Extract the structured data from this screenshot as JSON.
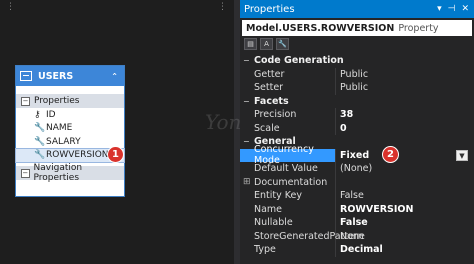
{
  "entity": {
    "name": "USERS",
    "properties_header": "Properties",
    "fields": [
      "ID",
      "NAME",
      "SALARY",
      "ROWVERSION"
    ],
    "nav_header": "Navigation Properties"
  },
  "badges": [
    "1",
    "2"
  ],
  "panel": {
    "title": "Properties",
    "buttons": [
      "▾",
      "⊣",
      "✕"
    ],
    "object_name": "Model.USERS.ROWVERSION",
    "object_type": "Property"
  },
  "grid": [
    {
      "category": "Code Generation",
      "rows": [
        {
          "name": "Getter",
          "value": "Public"
        },
        {
          "name": "Setter",
          "value": "Public"
        }
      ]
    },
    {
      "category": "Facets",
      "rows": [
        {
          "name": "Precision",
          "value": "38",
          "bold": true
        },
        {
          "name": "Scale",
          "value": "0",
          "bold": true
        }
      ]
    },
    {
      "category": "General",
      "rows": [
        {
          "name": "Concurrency Mode",
          "value": "Fixed",
          "bold": true,
          "selected": true
        },
        {
          "name": "Default Value",
          "value": "(None)"
        },
        {
          "name": "Documentation",
          "value": "",
          "expandable": true
        },
        {
          "name": "Entity Key",
          "value": "False"
        },
        {
          "name": "Name",
          "value": "ROWVERSION",
          "bold": true
        },
        {
          "name": "Nullable",
          "value": "False",
          "bold": true
        },
        {
          "name": "StoreGeneratedPattern",
          "value": "None"
        },
        {
          "name": "Type",
          "value": "Decimal",
          "bold": true
        }
      ]
    }
  ],
  "watermark": "Yon"
}
